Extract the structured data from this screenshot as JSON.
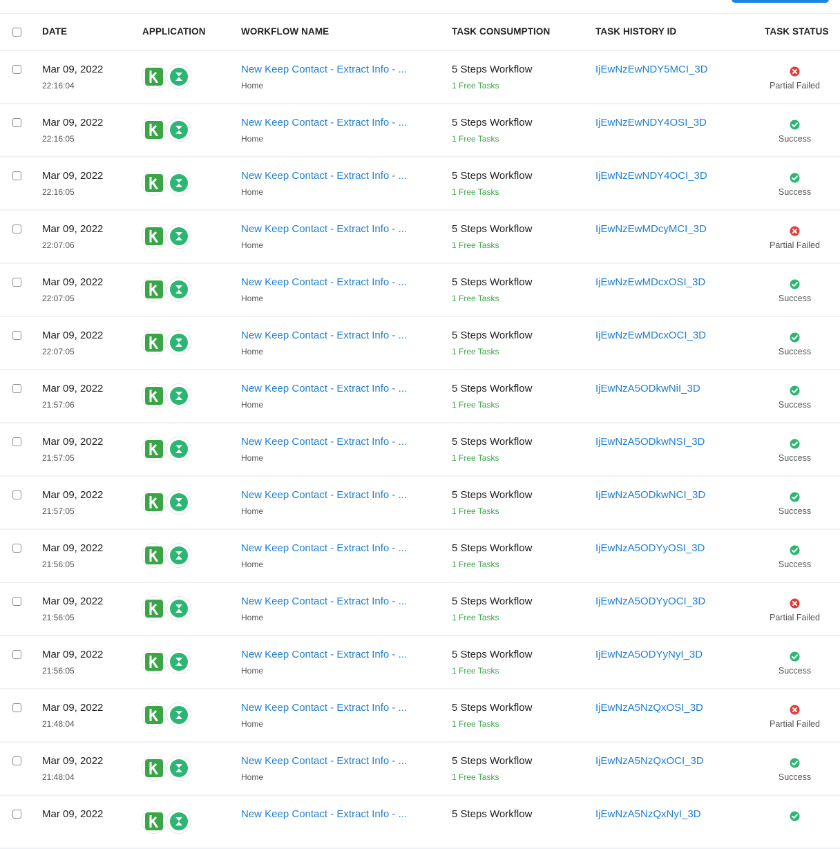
{
  "colors": {
    "link": "#1f7fd3",
    "free_tasks": "#3aa546",
    "success": "#2bb673",
    "failed": "#e23b3b",
    "primary_button": "#1a82e2"
  },
  "header": {
    "date": "DATE",
    "application": "APPLICATION",
    "workflow_name": "WORKFLOW NAME",
    "task_consumption": "TASK CONSUMPTION",
    "task_history_id": "TASK HISTORY ID",
    "task_status": "TASK STATUS"
  },
  "rows": [
    {
      "date": "Mar 09, 2022",
      "time": "22:16:04",
      "apps": [
        "k-app-icon",
        "hourglass-app-icon"
      ],
      "workflow": "New Keep Contact - Extract Info - ...",
      "folder": "Home",
      "consumption": "5 Steps Workflow",
      "free": "1 Free Tasks",
      "history_id": "IjEwNzEwNDY5MCI_3D",
      "status": "Partial Failed",
      "status_type": "failed"
    },
    {
      "date": "Mar 09, 2022",
      "time": "22:16:05",
      "apps": [
        "k-app-icon",
        "hourglass-app-icon"
      ],
      "workflow": "New Keep Contact - Extract Info - ...",
      "folder": "Home",
      "consumption": "5 Steps Workflow",
      "free": "1 Free Tasks",
      "history_id": "IjEwNzEwNDY4OSI_3D",
      "status": "Success",
      "status_type": "success"
    },
    {
      "date": "Mar 09, 2022",
      "time": "22:16:05",
      "apps": [
        "k-app-icon",
        "hourglass-app-icon"
      ],
      "workflow": "New Keep Contact - Extract Info - ...",
      "folder": "Home",
      "consumption": "5 Steps Workflow",
      "free": "1 Free Tasks",
      "history_id": "IjEwNzEwNDY4OCI_3D",
      "status": "Success",
      "status_type": "success"
    },
    {
      "date": "Mar 09, 2022",
      "time": "22:07:06",
      "apps": [
        "k-app-icon",
        "hourglass-app-icon"
      ],
      "workflow": "New Keep Contact - Extract Info - ...",
      "folder": "Home",
      "consumption": "5 Steps Workflow",
      "free": "1 Free Tasks",
      "history_id": "IjEwNzEwMDcyMCI_3D",
      "status": "Partial Failed",
      "status_type": "failed"
    },
    {
      "date": "Mar 09, 2022",
      "time": "22:07:05",
      "apps": [
        "k-app-icon",
        "hourglass-app-icon"
      ],
      "workflow": "New Keep Contact - Extract Info - ...",
      "folder": "Home",
      "consumption": "5 Steps Workflow",
      "free": "1 Free Tasks",
      "history_id": "IjEwNzEwMDcxOSI_3D",
      "status": "Success",
      "status_type": "success"
    },
    {
      "date": "Mar 09, 2022",
      "time": "22:07:05",
      "apps": [
        "k-app-icon",
        "hourglass-app-icon"
      ],
      "workflow": "New Keep Contact - Extract Info - ...",
      "folder": "Home",
      "consumption": "5 Steps Workflow",
      "free": "1 Free Tasks",
      "history_id": "IjEwNzEwMDcxOCI_3D",
      "status": "Success",
      "status_type": "success"
    },
    {
      "date": "Mar 09, 2022",
      "time": "21:57:06",
      "apps": [
        "k-app-icon",
        "hourglass-app-icon"
      ],
      "workflow": "New Keep Contact - Extract Info - ...",
      "folder": "Home",
      "consumption": "5 Steps Workflow",
      "free": "1 Free Tasks",
      "history_id": "IjEwNzA5ODkwNiI_3D",
      "status": "Success",
      "status_type": "success"
    },
    {
      "date": "Mar 09, 2022",
      "time": "21:57:05",
      "apps": [
        "k-app-icon",
        "hourglass-app-icon"
      ],
      "workflow": "New Keep Contact - Extract Info - ...",
      "folder": "Home",
      "consumption": "5 Steps Workflow",
      "free": "1 Free Tasks",
      "history_id": "IjEwNzA5ODkwNSI_3D",
      "status": "Success",
      "status_type": "success"
    },
    {
      "date": "Mar 09, 2022",
      "time": "21:57:05",
      "apps": [
        "k-app-icon",
        "hourglass-app-icon"
      ],
      "workflow": "New Keep Contact - Extract Info - ...",
      "folder": "Home",
      "consumption": "5 Steps Workflow",
      "free": "1 Free Tasks",
      "history_id": "IjEwNzA5ODkwNCI_3D",
      "status": "Success",
      "status_type": "success"
    },
    {
      "date": "Mar 09, 2022",
      "time": "21:56:05",
      "apps": [
        "k-app-icon",
        "hourglass-app-icon"
      ],
      "workflow": "New Keep Contact - Extract Info - ...",
      "folder": "Home",
      "consumption": "5 Steps Workflow",
      "free": "1 Free Tasks",
      "history_id": "IjEwNzA5ODYyOSI_3D",
      "status": "Success",
      "status_type": "success"
    },
    {
      "date": "Mar 09, 2022",
      "time": "21:56:05",
      "apps": [
        "k-app-icon",
        "hourglass-app-icon"
      ],
      "workflow": "New Keep Contact - Extract Info - ...",
      "folder": "Home",
      "consumption": "5 Steps Workflow",
      "free": "1 Free Tasks",
      "history_id": "IjEwNzA5ODYyOCI_3D",
      "status": "Partial Failed",
      "status_type": "failed"
    },
    {
      "date": "Mar 09, 2022",
      "time": "21:56:05",
      "apps": [
        "k-app-icon",
        "hourglass-app-icon"
      ],
      "workflow": "New Keep Contact - Extract Info - ...",
      "folder": "Home",
      "consumption": "5 Steps Workflow",
      "free": "1 Free Tasks",
      "history_id": "IjEwNzA5ODYyNyI_3D",
      "status": "Success",
      "status_type": "success"
    },
    {
      "date": "Mar 09, 2022",
      "time": "21:48:04",
      "apps": [
        "k-app-icon",
        "hourglass-app-icon"
      ],
      "workflow": "New Keep Contact - Extract Info - ...",
      "folder": "Home",
      "consumption": "5 Steps Workflow",
      "free": "1 Free Tasks",
      "history_id": "IjEwNzA5NzQxOSI_3D",
      "status": "Partial Failed",
      "status_type": "failed"
    },
    {
      "date": "Mar 09, 2022",
      "time": "21:48:04",
      "apps": [
        "k-app-icon",
        "hourglass-app-icon"
      ],
      "workflow": "New Keep Contact - Extract Info - ...",
      "folder": "Home",
      "consumption": "5 Steps Workflow",
      "free": "1 Free Tasks",
      "history_id": "IjEwNzA5NzQxOCI_3D",
      "status": "Success",
      "status_type": "success"
    },
    {
      "date": "Mar 09, 2022",
      "time": "",
      "apps": [
        "k-app-icon",
        "hourglass-app-icon"
      ],
      "workflow": "New Keep Contact - Extract Info - ...",
      "folder": "",
      "consumption": "5 Steps Workflow",
      "free": "",
      "history_id": "IjEwNzA5NzQxNyI_3D",
      "status": "",
      "status_type": "success"
    }
  ]
}
